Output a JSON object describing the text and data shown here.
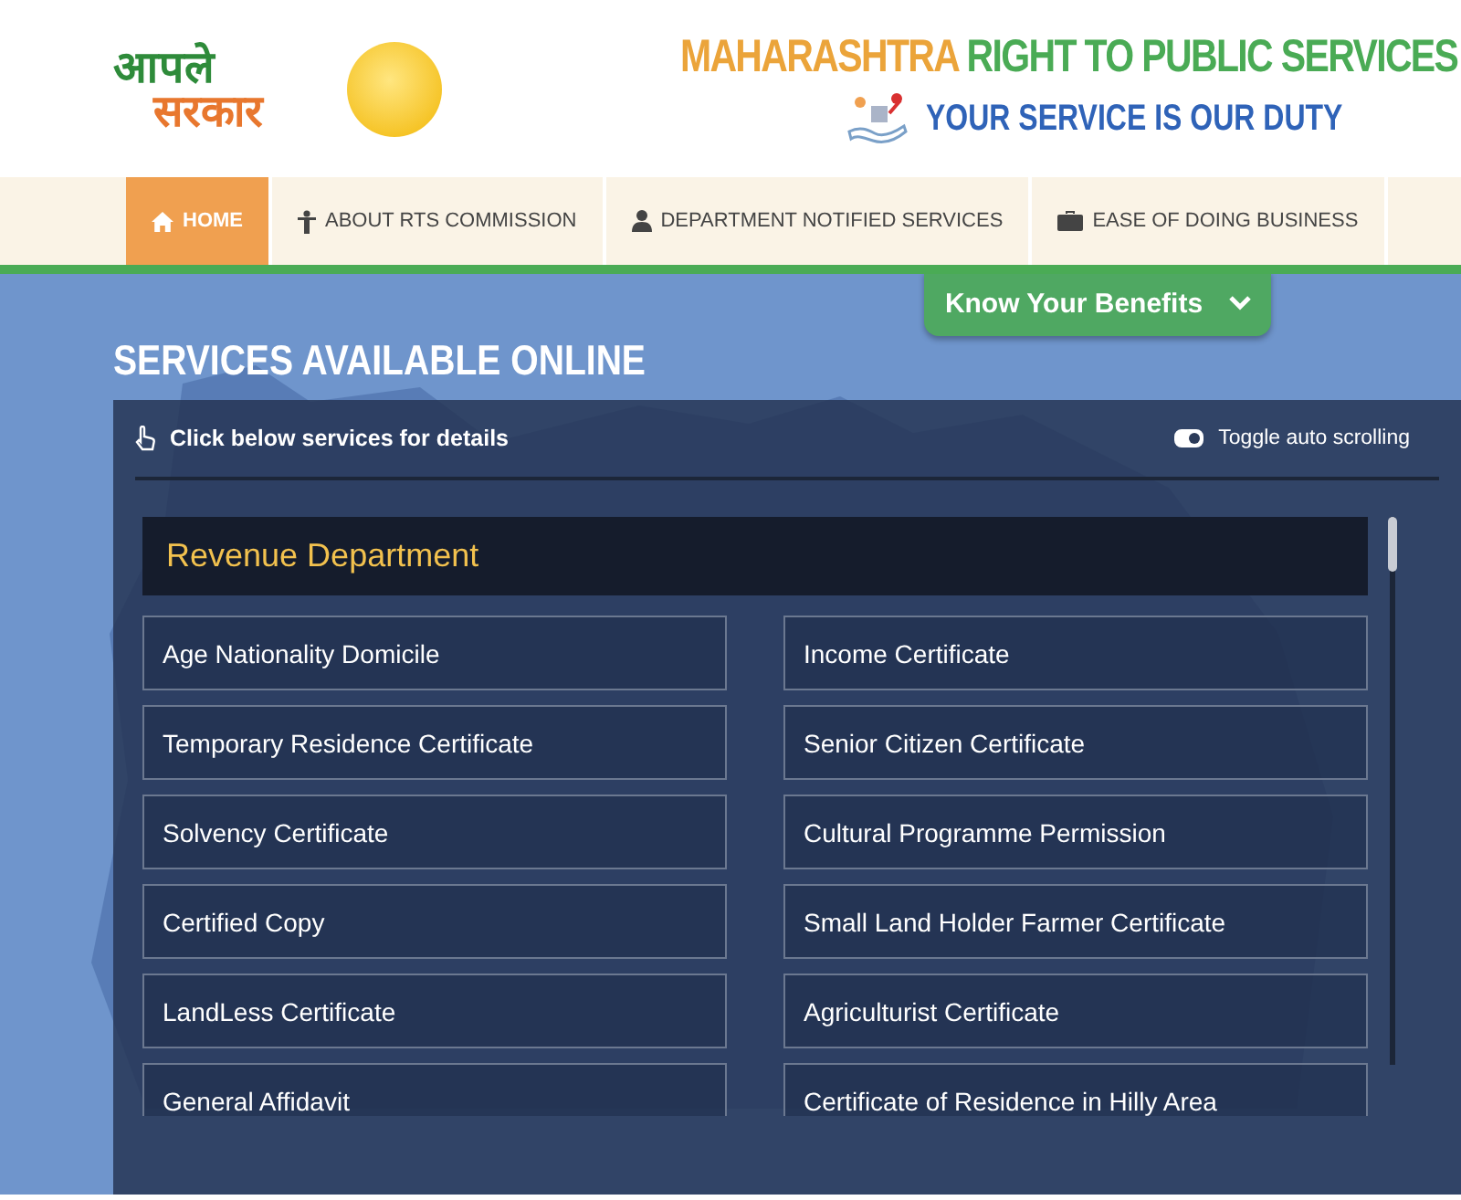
{
  "header": {
    "logo_text": [
      "आपले",
      "सरकार"
    ],
    "title_parts": [
      {
        "text": "MAHARASHTRA",
        "kind": "accent"
      },
      {
        "text": "RIGHT TO PUBLIC SERVICES",
        "kind": "main"
      }
    ],
    "tagline": "YOUR SERVICE IS OUR DUTY"
  },
  "nav": [
    {
      "label": "HOME",
      "kind": "home",
      "selected": true
    },
    {
      "label": "ABOUT RTS COMMISSION",
      "kind": "about",
      "selected": false
    },
    {
      "label": "DEPARTMENT NOTIFIED SERVICES",
      "kind": "services",
      "selected": false
    },
    {
      "label": "EASE OF DOING BUSINESS",
      "kind": "business",
      "selected": false
    }
  ],
  "benefits_button": "Know Your Benefits",
  "section_title": "SERVICES AVAILABLE ONLINE",
  "panel": {
    "hint": "Click below services for details",
    "toggle": {
      "label": "Toggle auto scrolling",
      "on": true
    },
    "department": "Revenue Department",
    "services": [
      "Age Nationality Domicile",
      "Income Certificate",
      "Temporary Residence Certificate",
      "Senior Citizen Certificate",
      "Solvency Certificate",
      "Cultural Programme Permission",
      "Certified Copy",
      "Small Land Holder Farmer Certificate",
      "LandLess Certificate",
      "Agriculturist Certificate",
      "General Affidavit",
      "Certificate of Residence in Hilly Area"
    ]
  }
}
